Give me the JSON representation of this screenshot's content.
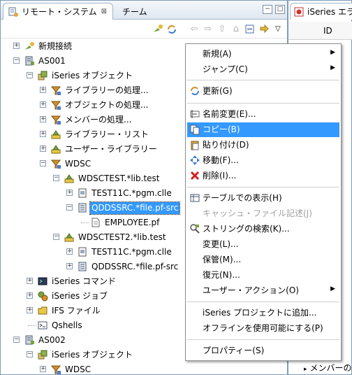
{
  "left_view": {
    "tabs": [
      {
        "label": "リモート・システム",
        "close": "⊠"
      },
      {
        "label": "チーム"
      }
    ],
    "window_buttons": {
      "minimize": "−",
      "maximize": "□"
    }
  },
  "tree": {
    "nodes": [
      {
        "label": "新規接続",
        "expander": "+"
      },
      {
        "label": "AS001",
        "expander": "−"
      },
      {
        "label": "iSeries オブジェクト",
        "expander": "−"
      },
      {
        "label": "ライブラリーの処理...",
        "expander": "+"
      },
      {
        "label": "オブジェクトの処理...",
        "expander": "+"
      },
      {
        "label": "メンバーの処理...",
        "expander": "+"
      },
      {
        "label": "ライブラリー・リスト",
        "expander": "+"
      },
      {
        "label": "ユーザー・ライブラリー",
        "expander": "+"
      },
      {
        "label": "WDSC",
        "expander": "−"
      },
      {
        "label": "WDSCTEST.*lib.test",
        "expander": "−"
      },
      {
        "label": "TEST11C.*pgm.clle",
        "expander": "+"
      },
      {
        "label": "QDDSSRC.*file.pf-src",
        "expander": "−"
      },
      {
        "label": "EMPLOYEE.pf",
        "expander": ""
      },
      {
        "label": "WDSCTEST2.*lib.test",
        "expander": "−"
      },
      {
        "label": "TEST11C.*pgm.clle",
        "expander": "+"
      },
      {
        "label": "QDDSSRC.*file.pf-src",
        "expander": "+"
      },
      {
        "label": "iSeries コマンド",
        "expander": "+"
      },
      {
        "label": "iSeries ジョブ",
        "expander": "+"
      },
      {
        "label": "IFS ファイル",
        "expander": "+"
      },
      {
        "label": "Qshells",
        "expander": ""
      },
      {
        "label": "AS002",
        "expander": "−"
      },
      {
        "label": "iSeries オブジェクト",
        "expander": "−"
      },
      {
        "label": "WDSC",
        "expander": "+"
      }
    ]
  },
  "right_view": {
    "tab_label": "iSeries エラ",
    "column_header": "ID",
    "bottom_item": "メンバーの",
    "arrow": "▸"
  },
  "context_menu": {
    "items": [
      {
        "label": "新規(A)",
        "submenu": "▶"
      },
      {
        "label": "ジャンプ(C)",
        "submenu": "▶"
      },
      {
        "label": "更新(G)"
      },
      {
        "label": "名前変更(E)..."
      },
      {
        "label": "コピー(B)"
      },
      {
        "label": "貼り付け(D)"
      },
      {
        "label": "移動(F)..."
      },
      {
        "label": "削除(I)..."
      },
      {
        "label": "テーブルでの表示(H)"
      },
      {
        "label": "キャッシュ・ファイル記述(J)"
      },
      {
        "label": "ストリングの検索(K)..."
      },
      {
        "label": "変更(L)..."
      },
      {
        "label": "保管(M)..."
      },
      {
        "label": "復元(N)..."
      },
      {
        "label": "ユーザー・アクション(O)",
        "submenu": "▶"
      },
      {
        "label": "iSeries プロジェクトに追加..."
      },
      {
        "label": "オフラインを使用可能にする(P)"
      },
      {
        "label": "プロパティー(S)"
      }
    ]
  },
  "colors": {
    "selection": "#3399ff",
    "border": "#7f9db9",
    "tab_bar": "#dfe7f1"
  }
}
